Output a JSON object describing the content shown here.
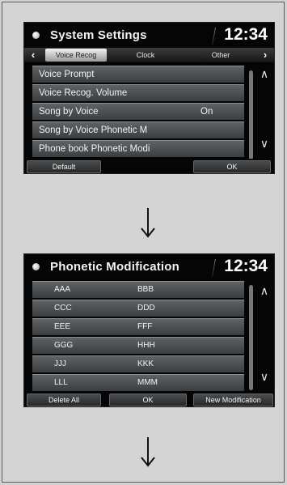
{
  "screen1": {
    "title": "System Settings",
    "clock": "12:34",
    "tabs": [
      {
        "label": "Voice Recog",
        "active": true
      },
      {
        "label": "Clock",
        "active": false
      },
      {
        "label": "Other",
        "active": false
      }
    ],
    "items": [
      {
        "label": "Voice Prompt",
        "value": ""
      },
      {
        "label": "Voice Recog. Volume",
        "value": ""
      },
      {
        "label": "Song by Voice",
        "value": "On"
      },
      {
        "label": "Song by Voice Phonetic M",
        "value": ""
      },
      {
        "label": "Phone book Phonetic Modi",
        "value": ""
      }
    ],
    "buttons": {
      "default": "Default",
      "ok": "OK"
    }
  },
  "screen2": {
    "title": "Phonetic Modification",
    "clock": "12:34",
    "rows": [
      [
        "AAA",
        "BBB"
      ],
      [
        "CCC",
        "DDD"
      ],
      [
        "EEE",
        "FFF"
      ],
      [
        "GGG",
        "HHH"
      ],
      [
        "JJJ",
        "KKK"
      ],
      [
        "LLL",
        "MMM"
      ]
    ],
    "buttons": {
      "delete_all": "Delete All",
      "ok": "OK",
      "new_modification": "New Modification"
    }
  },
  "icons": {
    "tab_left": "chevron-left-icon",
    "tab_right": "chevron-right-icon",
    "scroll_up": "double-chevron-up-icon",
    "scroll_down": "double-chevron-down-icon",
    "flow_arrow": "down-arrow-icon"
  },
  "colors": {
    "background": "#d2d2d2",
    "screen": "#050505",
    "row": "#4a4e51",
    "text": "#ffffff"
  }
}
